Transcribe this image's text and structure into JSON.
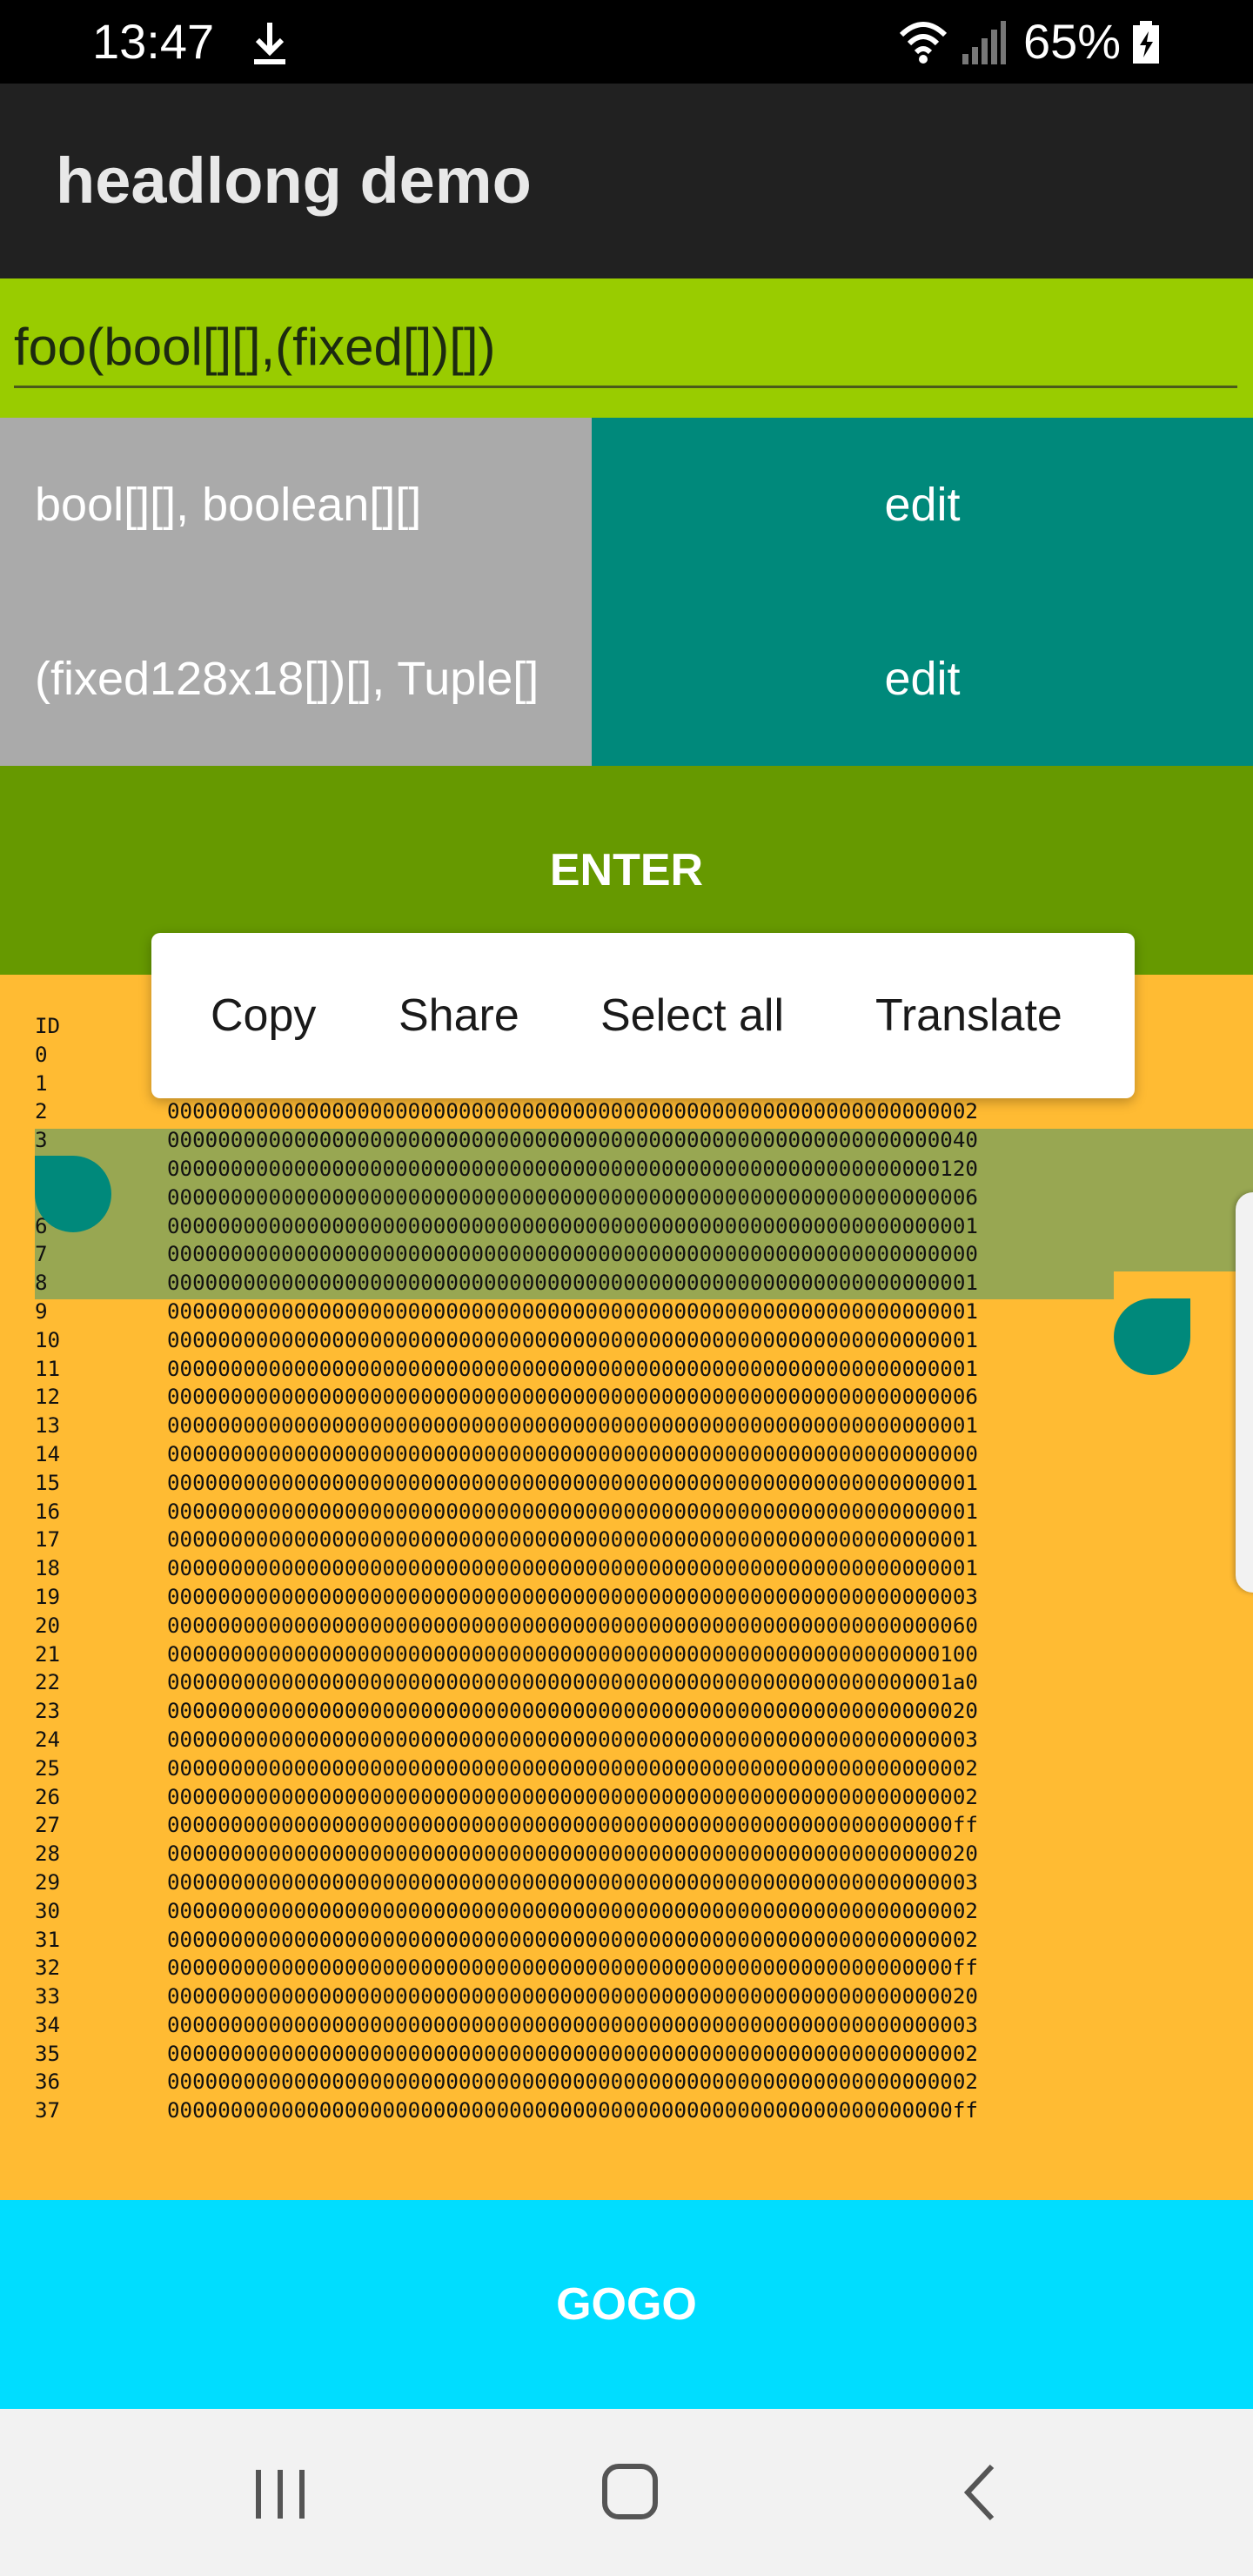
{
  "status_bar": {
    "time": "13:47",
    "battery_percent": "65%",
    "icons": [
      "download-icon",
      "wifi-icon",
      "signal-icon",
      "battery-charging-icon"
    ]
  },
  "app_bar": {
    "title": "headlong demo"
  },
  "signature": {
    "value": "foo(bool[][],(fixed[])[])"
  },
  "params": [
    {
      "label": "bool[][], boolean[][]",
      "edit_label": "edit"
    },
    {
      "label": "(fixed128x18[])[], Tuple[]",
      "edit_label": "edit"
    }
  ],
  "enter_label": "ENTER",
  "context_menu": {
    "items": [
      "Copy",
      "Share",
      "Select all",
      "Translate"
    ]
  },
  "output": {
    "header": "ID",
    "rows": [
      {
        "id": "0",
        "value": ""
      },
      {
        "id": "1",
        "value": ""
      },
      {
        "id": "2",
        "value": "0000000000000000000000000000000000000000000000000000000000000002"
      },
      {
        "id": "3",
        "value": "0000000000000000000000000000000000000000000000000000000000000040"
      },
      {
        "id": "4",
        "value": "0000000000000000000000000000000000000000000000000000000000000120"
      },
      {
        "id": "5",
        "value": "0000000000000000000000000000000000000000000000000000000000000006"
      },
      {
        "id": "6",
        "value": "0000000000000000000000000000000000000000000000000000000000000001"
      },
      {
        "id": "7",
        "value": "0000000000000000000000000000000000000000000000000000000000000000"
      },
      {
        "id": "8",
        "value": "0000000000000000000000000000000000000000000000000000000000000001"
      },
      {
        "id": "9",
        "value": "0000000000000000000000000000000000000000000000000000000000000001"
      },
      {
        "id": "10",
        "value": "0000000000000000000000000000000000000000000000000000000000000001"
      },
      {
        "id": "11",
        "value": "0000000000000000000000000000000000000000000000000000000000000001"
      },
      {
        "id": "12",
        "value": "0000000000000000000000000000000000000000000000000000000000000006"
      },
      {
        "id": "13",
        "value": "0000000000000000000000000000000000000000000000000000000000000001"
      },
      {
        "id": "14",
        "value": "0000000000000000000000000000000000000000000000000000000000000000"
      },
      {
        "id": "15",
        "value": "0000000000000000000000000000000000000000000000000000000000000001"
      },
      {
        "id": "16",
        "value": "0000000000000000000000000000000000000000000000000000000000000001"
      },
      {
        "id": "17",
        "value": "0000000000000000000000000000000000000000000000000000000000000001"
      },
      {
        "id": "18",
        "value": "0000000000000000000000000000000000000000000000000000000000000001"
      },
      {
        "id": "19",
        "value": "0000000000000000000000000000000000000000000000000000000000000003"
      },
      {
        "id": "20",
        "value": "0000000000000000000000000000000000000000000000000000000000000060"
      },
      {
        "id": "21",
        "value": "0000000000000000000000000000000000000000000000000000000000000100"
      },
      {
        "id": "22",
        "value": "00000000000000000000000000000000000000000000000000000000000001a0"
      },
      {
        "id": "23",
        "value": "0000000000000000000000000000000000000000000000000000000000000020"
      },
      {
        "id": "24",
        "value": "0000000000000000000000000000000000000000000000000000000000000003"
      },
      {
        "id": "25",
        "value": "0000000000000000000000000000000000000000000000000000000000000002"
      },
      {
        "id": "26",
        "value": "0000000000000000000000000000000000000000000000000000000000000002"
      },
      {
        "id": "27",
        "value": "00000000000000000000000000000000000000000000000000000000000000ff"
      },
      {
        "id": "28",
        "value": "0000000000000000000000000000000000000000000000000000000000000020"
      },
      {
        "id": "29",
        "value": "0000000000000000000000000000000000000000000000000000000000000003"
      },
      {
        "id": "30",
        "value": "0000000000000000000000000000000000000000000000000000000000000002"
      },
      {
        "id": "31",
        "value": "0000000000000000000000000000000000000000000000000000000000000002"
      },
      {
        "id": "32",
        "value": "00000000000000000000000000000000000000000000000000000000000000ff"
      },
      {
        "id": "33",
        "value": "0000000000000000000000000000000000000000000000000000000000000020"
      },
      {
        "id": "34",
        "value": "0000000000000000000000000000000000000000000000000000000000000003"
      },
      {
        "id": "35",
        "value": "0000000000000000000000000000000000000000000000000000000000000002"
      },
      {
        "id": "36",
        "value": "0000000000000000000000000000000000000000000000000000000000000002"
      },
      {
        "id": "37",
        "value": "00000000000000000000000000000000000000000000000000000000000000ff"
      }
    ]
  },
  "gogo_label": "GOGO",
  "nav_bar": {
    "icons": [
      "recent-apps-icon",
      "home-icon",
      "back-icon"
    ]
  },
  "colors": {
    "status_bar": "#000000",
    "app_bar": "#212121",
    "signature_bg": "#99cc00",
    "param_label_bg": "#aaaaaa",
    "edit_button": "#00897b",
    "enter_button": "#669900",
    "output_bg": "#ffbb33",
    "selection": "#98a752",
    "gogo_button": "#00ddff"
  }
}
